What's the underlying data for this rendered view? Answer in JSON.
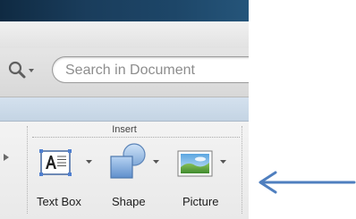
{
  "search": {
    "placeholder": "Search in Document",
    "scope_icon": "magnifier-dropdown-icon"
  },
  "ribbon": {
    "group_label": "Insert",
    "tools": [
      {
        "label": "Text Box",
        "icon": "text-box-icon"
      },
      {
        "label": "Shape",
        "icon": "shape-icon"
      },
      {
        "label": "Picture",
        "icon": "picture-icon"
      }
    ]
  },
  "colors": {
    "accent_blue": "#5b82b8",
    "arrow_blue": "#4f7fbf"
  }
}
